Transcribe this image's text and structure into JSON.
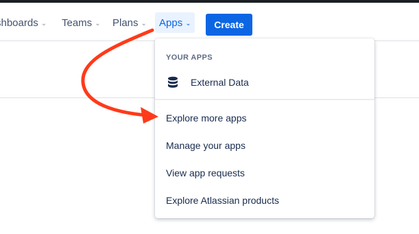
{
  "nav": {
    "dashboards": "shboards",
    "teams": "Teams",
    "plans": "Plans",
    "apps": "Apps",
    "create": "Create"
  },
  "dropdown": {
    "your_apps_heading": "YOUR APPS",
    "apps": [
      {
        "label": "External Data",
        "icon": "database-icon"
      }
    ],
    "items": [
      "Explore more apps",
      "Manage your apps",
      "View app requests",
      "Explore Atlassian products"
    ]
  },
  "colors": {
    "accent": "#0c66e4",
    "arrow": "#ff3a1a",
    "apps_active_bg": "#e9f2ff"
  },
  "icons": {
    "chevron": "chevron-down-icon",
    "annotation": "red-arrow-annotation"
  }
}
